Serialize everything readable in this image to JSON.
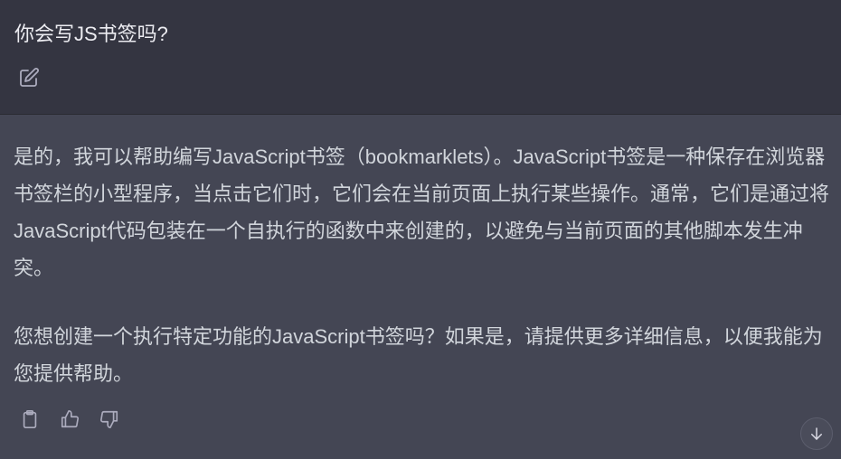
{
  "user_message": {
    "text": "你会写JS书签吗?",
    "edit_icon": "edit-icon"
  },
  "assistant_message": {
    "paragraphs": [
      "是的，我可以帮助编写JavaScript书签（bookmarklets）。JavaScript书签是一种保存在浏览器书签栏的小型程序，当点击它们时，它们会在当前页面上执行某些操作。通常，它们是通过将JavaScript代码包装在一个自执行的函数中来创建的，以避免与当前页面的其他脚本发生冲突。",
      "您想创建一个执行特定功能的JavaScript书签吗？如果是，请提供更多详细信息，以便我能为您提供帮助。"
    ],
    "action_icons": [
      "clipboard-icon",
      "thumbs-up-icon",
      "thumbs-down-icon"
    ]
  },
  "scroll_button_icon": "arrow-down-icon",
  "colors": {
    "user_bg": "#343541",
    "assistant_bg": "#444654",
    "text": "#d1d5db",
    "icon": "#acacbe"
  }
}
